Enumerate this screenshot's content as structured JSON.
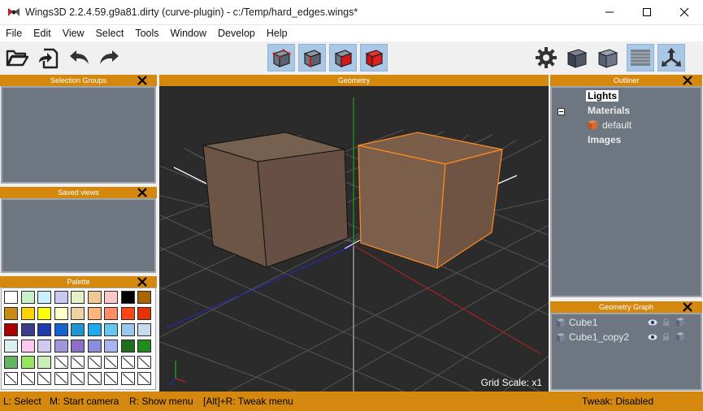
{
  "window": {
    "title": "Wings3D 2.2.4.59.g9a81.dirty (curve-plugin) - c:/Temp/hard_edges.wings*",
    "accent_color": "#d4880e"
  },
  "menu": {
    "items": [
      "File",
      "Edit",
      "View",
      "Select",
      "Tools",
      "Window",
      "Develop",
      "Help"
    ]
  },
  "toolbar": {
    "left_icons": [
      "open-folder-icon",
      "import-icon",
      "undo-icon",
      "redo-icon"
    ],
    "mode_icons": [
      "vertex-mode-icon",
      "edge-mode-icon",
      "face-mode-icon",
      "body-mode-icon"
    ],
    "right_icons": [
      "settings-gear-icon",
      "smooth-shade-icon",
      "flat-shade-icon",
      "ground-plane-icon",
      "axes-icon"
    ]
  },
  "panels": {
    "selection_groups": {
      "title": "Selection Groups"
    },
    "saved_views": {
      "title": "Saved views"
    },
    "palette": {
      "title": "Palette",
      "colors": [
        [
          "#ffffff",
          "#c8f0c8",
          "#c8f0ff",
          "#c8c8f0",
          "#e6f0c8",
          "#f0c896",
          "#ffc8c8",
          "#000000",
          "#aa6400"
        ],
        [
          "#c88c14",
          "#ffd200",
          "#ffff00",
          "#ffffc8",
          "#f0d2a0",
          "#ffb478",
          "#ff8c64",
          "#ff4614",
          "#e63200"
        ],
        [
          "#aa0000",
          "#3c3c8c",
          "#1e3caa",
          "#1464d2",
          "#1e96d2",
          "#1eaaf0",
          "#64c8f0",
          "#96c8f0",
          "#c8dcf0"
        ],
        [
          "#dcf0f0",
          "#ffc8f0",
          "#d2c8f0",
          "#a096dc",
          "#8c6ec8",
          "#8c8cdc",
          "#aab4f0",
          "#1e6e1e",
          "#1e8c1e"
        ],
        [
          "#64b464",
          "#96e664",
          "#c8f0b4",
          "",
          "",
          "",
          "",
          "",
          ""
        ],
        [
          "",
          "",
          "",
          "",
          "",
          "",
          "",
          "",
          ""
        ]
      ]
    },
    "geometry": {
      "title": "Geometry",
      "grid_scale": "Grid Scale: x1"
    },
    "outliner": {
      "title": "Outliner",
      "items": {
        "lights": "Lights",
        "materials": "Materials",
        "default": "default",
        "images": "Images"
      }
    },
    "geometry_graph": {
      "title": "Geometry Graph",
      "objects": [
        {
          "name": "Cube1"
        },
        {
          "name": "Cube1_copy2"
        }
      ]
    }
  },
  "status": {
    "select": "L: Select",
    "camera": "M: Start camera",
    "menu": "R: Show menu",
    "tweak_menu": "[Alt]+R: Tweak menu",
    "tweak": "Tweak: Disabled"
  }
}
